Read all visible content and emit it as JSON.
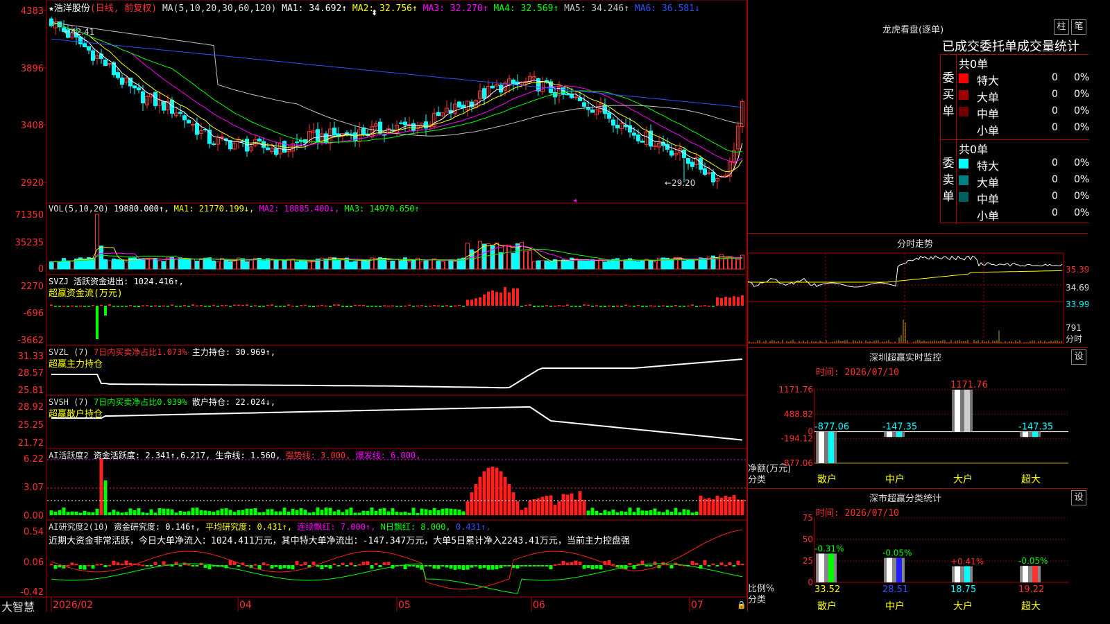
{
  "brand": "大智慧",
  "main_chart": {
    "stock_name": "★浩洋股份",
    "period": "(日线, 前复权)",
    "ma_params": "MA(5,10,20,30,60,120)",
    "ma_values": [
      {
        "label": "MA1:",
        "value": "34.692",
        "arrow": "↑",
        "color": "#ffffff"
      },
      {
        "label": "MA2:",
        "value": "32.756",
        "arrow": "↑",
        "color": "#ffff00"
      },
      {
        "label": "MA3:",
        "value": "32.270",
        "arrow": "↑",
        "color": "#ff00ff"
      },
      {
        "label": "MA4:",
        "value": "32.569",
        "arrow": "↑",
        "color": "#00ff00"
      },
      {
        "label": "MA5:",
        "value": "34.246",
        "arrow": "↑",
        "color": "#c0c0c0"
      },
      {
        "label": "MA6:",
        "value": "36.581",
        "arrow": "↓",
        "color": "#3050ff"
      }
    ],
    "y_ticks": [
      "4383",
      "3896",
      "3408",
      "2920"
    ],
    "high_annotation": "←42.41",
    "low_annotation": "←29.20",
    "x_labels": [
      "2026/02",
      "04",
      "05",
      "06",
      "07"
    ]
  },
  "vol": {
    "header": "VOL(5,10,20)",
    "current": "19880.000↑,",
    "ma1": "MA1: 21770.199↓,",
    "ma2": "MA2: 18885.400↓,",
    "ma3": "MA3: 14970.650↑",
    "y_ticks": [
      "71350",
      "35235",
      "0"
    ]
  },
  "svzj": {
    "header": "SVZJ  活跃资金进出: 1024.416↑,",
    "subtitle": "超赢资金流(万元)",
    "y_ticks": [
      "2270",
      "-696",
      "-3662"
    ]
  },
  "svzl": {
    "header_a": "SVZL (7)",
    "header_b": "7日内买卖净占比1.073%",
    "header_c": "主力持仓: 30.969↑,",
    "subtitle": "超赢主力持仓",
    "y_ticks": [
      "31.33",
      "28.57",
      "25.81"
    ]
  },
  "svsh": {
    "header_a": "SVSH (7)",
    "header_b": "7日内买卖净占比0.939%",
    "header_c": "散户持仓: 22.024↓,",
    "subtitle": "超赢散户持仓",
    "y_ticks": [
      "28.92",
      "25.25",
      "21.72"
    ]
  },
  "ai_active": {
    "header_a": "AI活跃度2",
    "header_b": "资金活跃度: 2.341↑,6.217,",
    "header_c": "生命线: 1.560,",
    "header_d": "强势线: 3.000,",
    "header_e": "爆发线: 6.000,",
    "y_ticks": [
      "6.22",
      "3.07",
      "0.00"
    ]
  },
  "ai_research": {
    "header_a": "AI研究度2(10)",
    "header_b": "资金研究度: 0.146↑,",
    "header_c": "平均研究度: 0.431↑,",
    "header_d": "连续飘红: 7.000↑,",
    "header_e": "N日飘红: 8.000,",
    "header_f": "0.431↑,",
    "commentary": "近期大资金非常活跃，今日大单净流入：1024.411万元，其中特大单净流出：-147.347万元，大单5日累计净入2243.41万元，当前主力控盘强",
    "y_ticks": [
      "0.54",
      "0.06",
      "-0.42"
    ]
  },
  "dragon_tiger": {
    "title": "龙虎看盘(逐单)",
    "btn_a": "柱",
    "btn_b": "笔",
    "tabs": "已成交委托单成交量统计",
    "buy_label": "委买单",
    "sell_label": "委卖单",
    "buy_total": "共0单",
    "sell_total": "共0单",
    "buy_rows": [
      {
        "name": "特大",
        "count": "0",
        "pct": "0%",
        "color": "#ff0000"
      },
      {
        "name": "大单",
        "count": "0",
        "pct": "0%",
        "color": "#a00000"
      },
      {
        "name": "中单",
        "count": "0",
        "pct": "0%",
        "color": "#700000"
      },
      {
        "name": "小单",
        "count": "0",
        "pct": "0%",
        "color": ""
      }
    ],
    "sell_rows": [
      {
        "name": "特大",
        "count": "0",
        "pct": "0%",
        "color": "#00ffff"
      },
      {
        "name": "大单",
        "count": "0",
        "pct": "0%",
        "color": "#008080"
      },
      {
        "name": "中单",
        "count": "0",
        "pct": "0%",
        "color": "#006060"
      },
      {
        "name": "小单",
        "count": "0",
        "pct": "0%",
        "color": ""
      }
    ]
  },
  "intraday": {
    "title": "分时走势",
    "price_ticks": [
      "35.39",
      "34.69",
      "33.99"
    ],
    "vol_ticks": [
      "791",
      "分时"
    ]
  },
  "sz_monitor": {
    "title": "深圳超赢实时监控",
    "btn": "设",
    "time": "时间: 2026/07/10",
    "y_ticks": [
      "1171.76",
      "488.82",
      "0",
      "-194.12",
      "-877.06"
    ],
    "y_unit_a": "净额(万元)",
    "y_unit_b": "分类",
    "bars": [
      {
        "name": "散户",
        "value": -877.06,
        "label": "-877.06",
        "label_color": "#00ffff"
      },
      {
        "name": "中户",
        "value": -147.35,
        "label": "-147.35",
        "label_color": "#00ffff"
      },
      {
        "name": "大户",
        "value": 1171.76,
        "label": "1171.76",
        "label_color": "#ff3030"
      },
      {
        "name": "超大",
        "value": -147.35,
        "label": "-147.35",
        "label_color": "#00ffff"
      }
    ]
  },
  "sz_class": {
    "title": "深市超赢分类统计",
    "btn": "设",
    "time": "时间: 2026/07/10",
    "y_ticks": [
      "75",
      "50",
      "25",
      "0"
    ],
    "y_unit_a": "比例%",
    "y_unit_b": "分类",
    "bars": [
      {
        "name": "散户",
        "value": 33.52,
        "label": "33.52",
        "delta": "-0.31%",
        "delta_color": "#00ff00",
        "bar_color": "#00ff00"
      },
      {
        "name": "中户",
        "value": 28.51,
        "label": "28.51",
        "delta": "-0.05%",
        "delta_color": "#00ff00",
        "bar_color": "#2020ff"
      },
      {
        "name": "大户",
        "value": 18.75,
        "label": "18.75",
        "delta": "+0.41%",
        "delta_color": "#ff3030",
        "bar_color": "#00ffff"
      },
      {
        "name": "超大",
        "value": 19.22,
        "label": "19.22",
        "delta": "-0.05%",
        "delta_color": "#00ff00",
        "bar_color": "#ff3030"
      }
    ]
  },
  "chart_data": {
    "type": "candlestick",
    "price_range": [
      29.2,
      43.83
    ],
    "candles_ohlc_approx": "derived series (see script)",
    "high": 42.41,
    "low": 29.2
  }
}
